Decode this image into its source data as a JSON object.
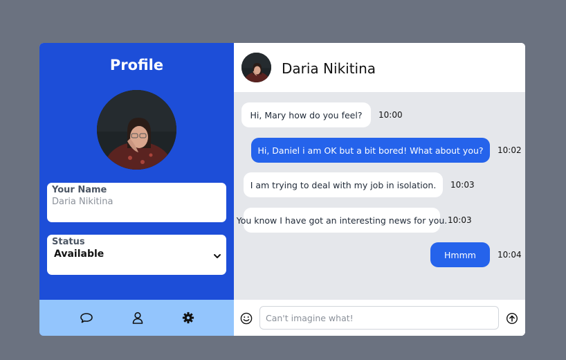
{
  "profile": {
    "title": "Profile",
    "name_label": "Your Name",
    "name_value": "Daria Nikitina",
    "status_label": "Status",
    "status_value": "Available"
  },
  "nav": {
    "icons": [
      "chat-bubble-icon",
      "user-icon",
      "gear-icon"
    ]
  },
  "chat": {
    "contact_name": "Daria Nikitina",
    "messages": [
      {
        "text": "Hi, Mary how do you feel?",
        "time": "10:00",
        "direction": "in"
      },
      {
        "text": "Hi, Daniel i am OK but a bit bored! What about you?",
        "time": "10:02",
        "direction": "out"
      },
      {
        "text": "I am trying to deal with my job in isolation.",
        "time": "10:03",
        "direction": "in"
      },
      {
        "text": "You know I have got an interesting news for you.",
        "time": "10:03",
        "direction": "in"
      },
      {
        "text": "Hmmm",
        "time": "10:04",
        "direction": "out"
      }
    ],
    "input_placeholder": "Can't imagine what!"
  },
  "colors": {
    "sidebar": "#1d4ed8",
    "sidebar_nav": "#93c5fd",
    "outgoing_bubble": "#2563eb",
    "chat_bg": "#e5e7eb"
  }
}
